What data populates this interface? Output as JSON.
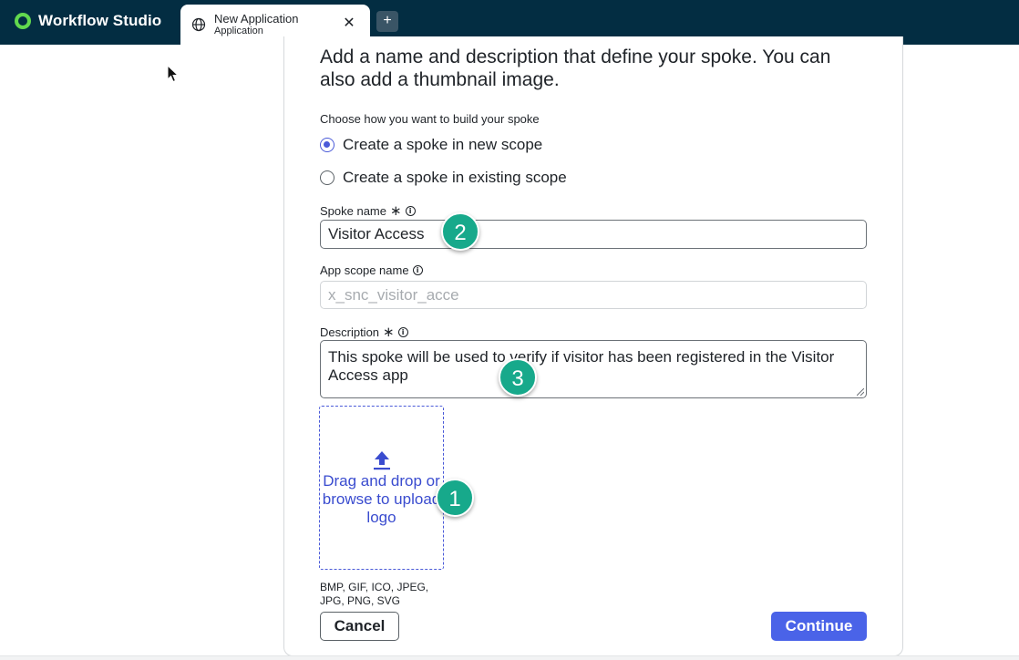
{
  "app": {
    "name": "Workflow Studio"
  },
  "tab": {
    "title": "New Application",
    "subtitle": "Application",
    "close": "✕",
    "add": "+"
  },
  "form": {
    "intro": "Add a name and description that define your spoke. You can also add a thumbnail image.",
    "build_label": "Choose how you want to build your spoke",
    "options": [
      {
        "label": "Create a spoke in new scope",
        "selected": true
      },
      {
        "label": "Create a spoke in existing scope",
        "selected": false
      }
    ],
    "spoke_name": {
      "label": "Spoke name",
      "required": "∗",
      "value": "Visitor Access"
    },
    "scope_name": {
      "label": "App scope name",
      "placeholder": "x_snc_visitor_acce"
    },
    "description": {
      "label": "Description",
      "required": "∗",
      "value": "This spoke will be used to verify if visitor has been registered in the Visitor Access app"
    },
    "upload": {
      "text": "Drag and drop or browse to upload logo",
      "formats": "BMP, GIF, ICO, JPEG, JPG, PNG, SVG"
    },
    "cancel_label": "Cancel",
    "continue_label": "Continue"
  },
  "markers": [
    "1",
    "2",
    "3"
  ],
  "colors": {
    "topbar": "#032d42",
    "accent": "#4a63e8",
    "marker": "#17a98b",
    "logo": "#62d84e"
  }
}
